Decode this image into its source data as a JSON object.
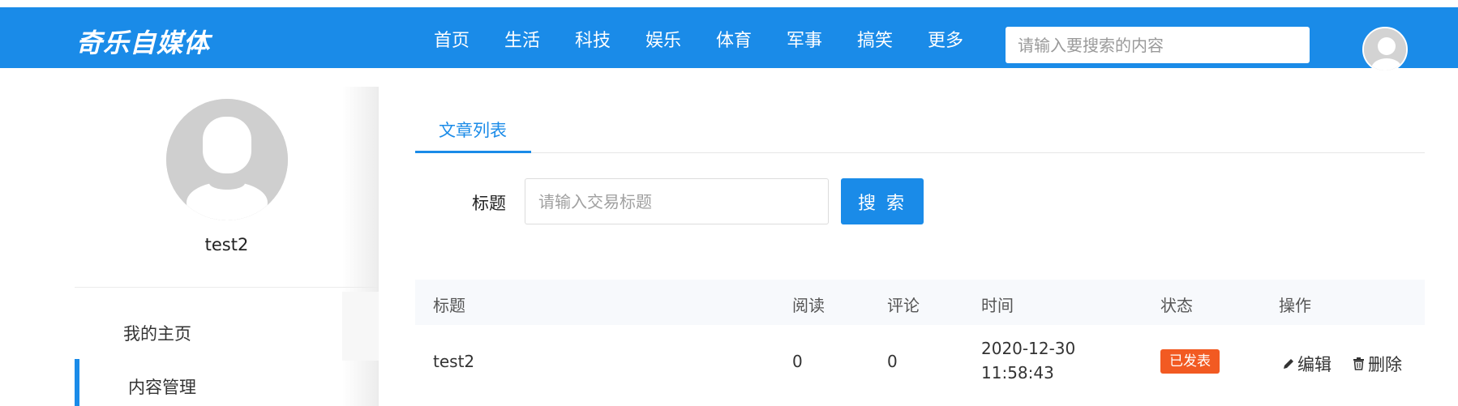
{
  "header": {
    "logo": "奇乐自媒体",
    "nav": [
      "首页",
      "生活",
      "科技",
      "娱乐",
      "体育",
      "军事",
      "搞笑",
      "更多"
    ],
    "search_placeholder": "请输入要搜索的内容",
    "brand_color": "#1a8be8"
  },
  "sidebar": {
    "username": "test2",
    "menu": [
      "我的主页",
      "内容管理"
    ],
    "active_item": "内容管理"
  },
  "main": {
    "tabs": [
      "文章列表"
    ],
    "filter": {
      "label": "标题",
      "placeholder": "请输入交易标题",
      "button": "搜 索"
    },
    "table": {
      "columns": [
        "标题",
        "阅读",
        "评论",
        "时间",
        "状态",
        "操作"
      ],
      "rows": [
        {
          "title": "test2",
          "reads": "0",
          "comments": "0",
          "date": "2020-12-30",
          "time": "11:58:43",
          "status": "已发表",
          "status_color": "#f25a22",
          "edit": "编辑",
          "delete": "删除",
          "edit_icon": "pencil-icon",
          "delete_icon": "trash-icon"
        }
      ]
    }
  }
}
